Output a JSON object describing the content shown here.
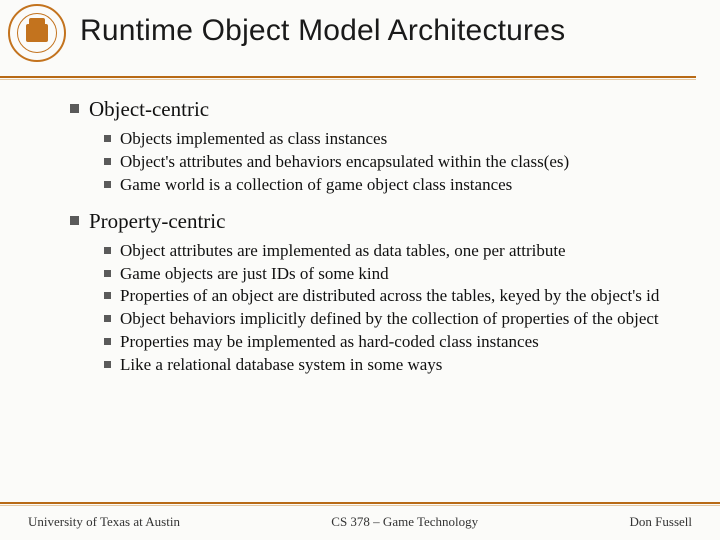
{
  "title": "Runtime Object Model Architectures",
  "sections": [
    {
      "heading": "Object-centric",
      "items": [
        "Objects implemented as class instances",
        "Object's attributes and behaviors encapsulated within the class(es)",
        "Game world is a collection of game object class instances"
      ]
    },
    {
      "heading": "Property-centric",
      "items": [
        "Object attributes are implemented as data tables, one per attribute",
        " Game objects are just IDs of some kind",
        "Properties of an object are distributed across the tables, keyed by the object's id",
        "Object behaviors implicitly defined by the collection of properties of the object",
        "Properties may be implemented as hard-coded class instances",
        "Like a relational database system in some ways"
      ]
    }
  ],
  "footer": {
    "left": "University of Texas at Austin",
    "center": "CS 378 – Game Technology",
    "right": "Don Fussell"
  }
}
